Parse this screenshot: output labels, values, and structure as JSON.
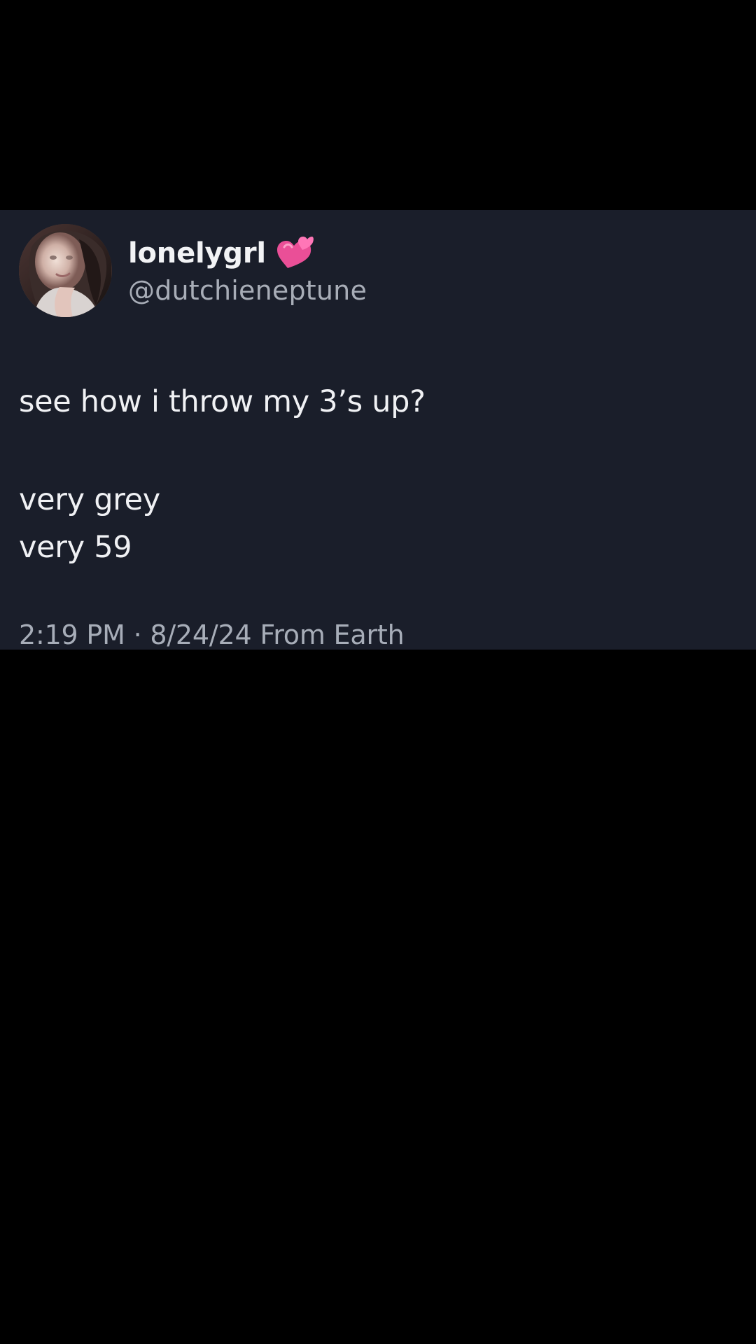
{
  "tweet": {
    "display_name": "lonelygrl",
    "name_icon": "pink-two-hearts-icon",
    "handle": "@dutchieneptune",
    "lines": [
      "see how i throw my 3’s up?",
      "very grey",
      "very 59"
    ],
    "timestamp": "2:19 PM · 8/24/24 From Earth"
  },
  "colors": {
    "page_background": "#000000",
    "card_background": "#1a1e2a",
    "primary_text": "#f2f3f5",
    "secondary_text": "#a8adb7",
    "heart_pink": "#ea4f97"
  }
}
